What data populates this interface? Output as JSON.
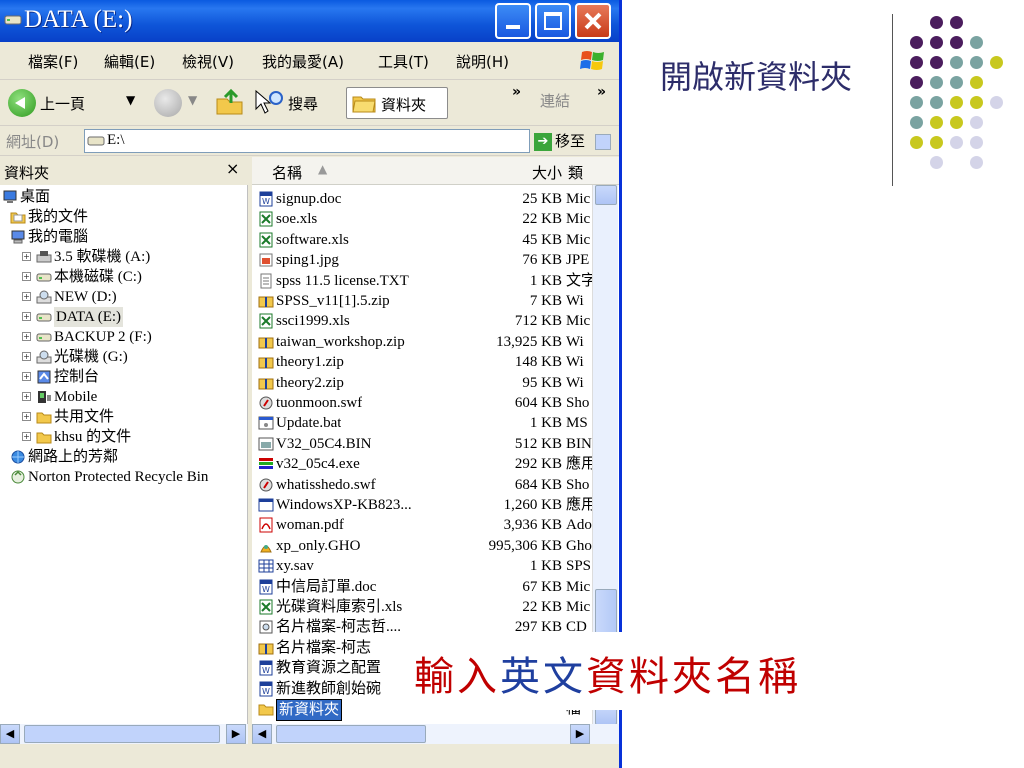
{
  "window": {
    "title": "DATA (E:)"
  },
  "menu": [
    "檔案(F)",
    "編輯(E)",
    "檢視(V)",
    "我的最愛(A)",
    "工具(T)",
    "說明(H)"
  ],
  "toolbar": {
    "back_label": "上一頁",
    "search_label": "搜尋",
    "folders_label": "資料夾",
    "links_label": "連結",
    "more": "»"
  },
  "address": {
    "label": "網址(D)",
    "value": "E:\\",
    "go_label": "移至"
  },
  "folders_pane": {
    "title": "資料夾",
    "close": "×",
    "items": [
      {
        "label": "桌面",
        "icon": "desktop-icon",
        "indent": 0,
        "expander": ""
      },
      {
        "label": "我的文件",
        "icon": "my-documents-icon",
        "indent": 1,
        "expander": ""
      },
      {
        "label": "我的電腦",
        "icon": "my-computer-icon",
        "indent": 1,
        "expander": ""
      },
      {
        "label": "3.5 軟碟機 (A:)",
        "icon": "floppy-drive-icon",
        "indent": 2,
        "expander": "+"
      },
      {
        "label": "本機磁碟 (C:)",
        "icon": "hard-drive-icon",
        "indent": 2,
        "expander": "+"
      },
      {
        "label": "NEW (D:)",
        "icon": "cd-drive-icon",
        "indent": 2,
        "expander": "+"
      },
      {
        "label": "DATA (E:)",
        "icon": "hard-drive-icon",
        "indent": 2,
        "expander": "+",
        "selected": true
      },
      {
        "label": "BACKUP 2 (F:)",
        "icon": "hard-drive-icon",
        "indent": 2,
        "expander": "+"
      },
      {
        "label": "光碟機 (G:)",
        "icon": "cd-drive-icon",
        "indent": 2,
        "expander": "+"
      },
      {
        "label": "控制台",
        "icon": "control-panel-icon",
        "indent": 2,
        "expander": "+"
      },
      {
        "label": "Mobile",
        "icon": "mobile-device-icon",
        "indent": 2,
        "expander": "+"
      },
      {
        "label": "共用文件",
        "icon": "folder-icon",
        "indent": 2,
        "expander": "+"
      },
      {
        "label": "khsu 的文件",
        "icon": "folder-icon",
        "indent": 2,
        "expander": "+"
      },
      {
        "label": "網路上的芳鄰",
        "icon": "network-icon",
        "indent": 1,
        "expander": ""
      },
      {
        "label": "Norton Protected Recycle Bin",
        "icon": "recycle-bin-icon",
        "indent": 1,
        "expander": ""
      }
    ]
  },
  "file_list": {
    "columns": {
      "name": "名稱",
      "size": "大小",
      "type": "類"
    },
    "sort_indicator": "▲",
    "files": [
      {
        "name": "signup.doc",
        "size": "25 KB",
        "type": "Mic",
        "icon": "word-doc-icon"
      },
      {
        "name": "soe.xls",
        "size": "22 KB",
        "type": "Mic",
        "icon": "excel-icon"
      },
      {
        "name": "software.xls",
        "size": "45 KB",
        "type": "Mic",
        "icon": "excel-icon"
      },
      {
        "name": "sping1.jpg",
        "size": "76 KB",
        "type": "JPE",
        "icon": "image-icon"
      },
      {
        "name": "spss 11.5 license.TXT",
        "size": "1 KB",
        "type": "文字",
        "icon": "text-file-icon"
      },
      {
        "name": "SPSS_v11[1].5.zip",
        "size": "7 KB",
        "type": "Wi",
        "icon": "zip-icon"
      },
      {
        "name": "ssci1999.xls",
        "size": "712 KB",
        "type": "Mic",
        "icon": "excel-icon"
      },
      {
        "name": "taiwan_workshop.zip",
        "size": "13,925 KB",
        "type": "Wi",
        "icon": "zip-icon"
      },
      {
        "name": "theory1.zip",
        "size": "148 KB",
        "type": "Wi",
        "icon": "zip-icon"
      },
      {
        "name": "theory2.zip",
        "size": "95 KB",
        "type": "Wi",
        "icon": "zip-icon"
      },
      {
        "name": "tuonmoon.swf",
        "size": "604 KB",
        "type": "Sho",
        "icon": "flash-icon"
      },
      {
        "name": "Update.bat",
        "size": "1 KB",
        "type": "MS",
        "icon": "batch-file-icon"
      },
      {
        "name": "V32_05C4.BIN",
        "size": "512 KB",
        "type": "BIN",
        "icon": "bin-file-icon"
      },
      {
        "name": "v32_05c4.exe",
        "size": "292 KB",
        "type": "應用",
        "icon": "exe-icon"
      },
      {
        "name": "whatisshedo.swf",
        "size": "684 KB",
        "type": "Sho",
        "icon": "flash-icon"
      },
      {
        "name": "WindowsXP-KB823...",
        "size": "1,260 KB",
        "type": "應用",
        "icon": "exe-window-icon"
      },
      {
        "name": "woman.pdf",
        "size": "3,936 KB",
        "type": "Ado",
        "icon": "pdf-icon"
      },
      {
        "name": "xp_only.GHO",
        "size": "995,306 KB",
        "type": "Gho",
        "icon": "ghost-icon"
      },
      {
        "name": "xy.sav",
        "size": "1 KB",
        "type": "SPS",
        "icon": "spss-data-icon"
      },
      {
        "name": "中信局訂單.doc",
        "size": "67 KB",
        "type": "Mic",
        "icon": "word-doc-icon"
      },
      {
        "name": "光碟資料庫索引.xls",
        "size": "22 KB",
        "type": "Mic",
        "icon": "excel-icon"
      },
      {
        "name": "名片檔案-柯志哲....",
        "size": "297 KB",
        "type": "CD",
        "icon": "cd-file-icon"
      },
      {
        "name": "名片檔案-柯志",
        "size": "",
        "type": "",
        "icon": "zip-icon"
      },
      {
        "name": "教育資源之配置",
        "size": "",
        "type": "",
        "icon": "word-doc-icon"
      },
      {
        "name": "新進教師創始碗",
        "size": "",
        "type": "",
        "icon": "word-doc-icon"
      }
    ],
    "new_folder": {
      "name": "新資料夾",
      "type": "檔",
      "icon": "folder-icon"
    }
  },
  "callout": {
    "text": "輸入英文資料夾名稱",
    "colors": [
      "#c00000",
      "#c00000",
      "#1f3f9f",
      "#1f3f9f",
      "#c00000",
      "#c00000",
      "#c00000",
      "#c00000",
      "#c00000"
    ]
  },
  "slide": {
    "title": "開啟新資料夾"
  },
  "colors": {
    "purple": "#4b1d5e",
    "teal": "#7aa3a1",
    "olive": "#c8c81e",
    "lavender": "#d4d4e8"
  }
}
